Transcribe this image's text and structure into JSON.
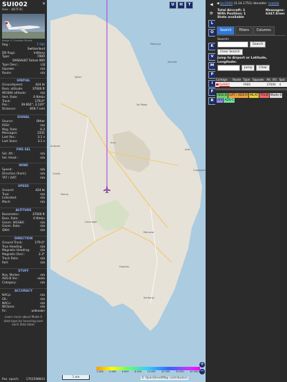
{
  "selected": {
    "callsign": "SUI002",
    "hex_label": "Hex :",
    "hex": "4B7F4C",
    "close": "✕",
    "photo_caption": "Image © Christian Mrolek"
  },
  "info_rows": [
    {
      "k": "Reg.:",
      "v": "T-785",
      "link": true
    },
    {
      "k": "",
      "v": "Switzerland"
    },
    {
      "k": "DB flags:",
      "v": "military"
    },
    {
      "k": "Type:",
      "v": "F900"
    },
    {
      "k": "",
      "v": "DASSAULT Falcon 900"
    },
    {
      "k": "Type Desc.:",
      "v": "L3J"
    },
    {
      "k": "Squawk:",
      "v": "n/a"
    },
    {
      "k": "Route:",
      "v": "n/a"
    }
  ],
  "sections": [
    {
      "title": "SPATIAL",
      "rows": [
        {
          "k": "Groundspeed:",
          "v": "424 kt"
        },
        {
          "k": "Baro. altitude:",
          "v": "37000 ft"
        },
        {
          "k": "WGS84 altitude:",
          "v": "n/a"
        },
        {
          "k": "Vert. Rate:",
          "v": "0 ft/min"
        },
        {
          "k": "Track:",
          "v": "179.0°"
        },
        {
          "k": "Pos.:",
          "v": "39.662°, 3.120°"
        },
        {
          "k": "Distance:",
          "v": "819.7 nmi"
        }
      ]
    },
    {
      "title": "SIGNAL",
      "rows": [
        {
          "k": "Source:",
          "v": "Other"
        },
        {
          "k": "RSSI:",
          "v": "n/a"
        },
        {
          "k": "Msg. Rate:",
          "v": "0.3"
        },
        {
          "k": "Messages:",
          "v": "2331"
        },
        {
          "k": "Last Pos.:",
          "v": "3.1 s"
        },
        {
          "k": "Last Seen:",
          "v": "3.1 s"
        }
      ]
    },
    {
      "title": "FMS SEL",
      "rows": [
        {
          "k": "Sel. Alt.:",
          "v": "n/a"
        },
        {
          "k": "Sel. Head.:",
          "v": "n/a"
        }
      ]
    },
    {
      "title": "WIND",
      "rows": [
        {
          "k": "Speed:",
          "v": "n/a"
        },
        {
          "k": "Direction (from):",
          "v": "n/a"
        },
        {
          "k": "TAT / OAT:",
          "v": "n/a"
        }
      ]
    },
    {
      "title": "SPEED",
      "rows": [
        {
          "k": "Ground:",
          "v": "424 kt"
        },
        {
          "k": "True:",
          "v": "n/a"
        },
        {
          "k": "Indicated:",
          "v": "n/a"
        },
        {
          "k": "Mach:",
          "v": "n/a"
        }
      ]
    },
    {
      "title": "ALTITUDE",
      "rows": [
        {
          "k": "Barometric:",
          "v": "37000 ft"
        },
        {
          "k": "Baro. Rate:",
          "v": "0 ft/min"
        },
        {
          "k": "Geom. WGS84:",
          "v": "n/a"
        },
        {
          "k": "Geom. Rate:",
          "v": "n/a"
        },
        {
          "k": "QNH:",
          "v": "n/a"
        }
      ]
    },
    {
      "title": "DIRECTION",
      "rows": [
        {
          "k": "Ground Track:",
          "v": "179.0°"
        },
        {
          "k": "True Heading:",
          "v": "n/a"
        },
        {
          "k": "Magnetic Heading:",
          "v": "n/a"
        },
        {
          "k": "Magnetic Decl.:",
          "v": "2.3°"
        },
        {
          "k": "Track Rate:",
          "v": "n/a"
        },
        {
          "k": "Roll:",
          "v": "n/a"
        }
      ]
    },
    {
      "title": "STUFF",
      "rows": [
        {
          "k": "Nav. Modes:",
          "v": "n/a"
        },
        {
          "k": "ADS-B Ver.:",
          "v": "none"
        },
        {
          "k": "Category:",
          "v": "n/a"
        }
      ]
    },
    {
      "title": "ACCURACY",
      "rows": [
        {
          "k": "NACp:",
          "v": "n/a"
        },
        {
          "k": "SIL:",
          "v": "n/a"
        },
        {
          "k": "NACv:",
          "v": "n/a"
        },
        {
          "k": "NICbaro:",
          "v": "n/a"
        },
        {
          "k": "Rc:",
          "v": "unknown"
        }
      ]
    }
  ],
  "learn_more": "Learn more about Mode S data type by hovering over each data label.",
  "pos_epoch_label": "Pos. epoch:",
  "pos_epoch": "1763598843",
  "map": {
    "top_buttons": [
      "U",
      "H",
      "T"
    ],
    "places": [
      "Pollença",
      "Alcúdia",
      "Sóller",
      "Inca",
      "Sa Pobla",
      "Manacor",
      "Felanitx",
      "Santanyí",
      "Llucmajor",
      "Palma",
      "Calvià",
      "Andratx",
      "Artà",
      "Capdepera"
    ],
    "scale": "1 nm",
    "color_ticks": [
      "2 000",
      "4 000",
      "6 000",
      "8 000",
      "10 000",
      "20 000",
      "30 000",
      "40 000+"
    ],
    "attribution": "© OpenStreetMap contributors",
    "zoom_in": "+",
    "zoom_out": "−"
  },
  "side_buttons": [
    "◀",
    "⟳",
    "L",
    "O",
    "K",
    "V",
    "M",
    "P",
    "I",
    "F",
    "R"
  ],
  "right": {
    "version_prefix": "◀ ",
    "version_link": "tar1090",
    "version_suffix": " (3.14.1751) decoder: ",
    "decoder_link": "readsb",
    "total_label": "Total Aircraft:",
    "total": "1",
    "messages_label": "Messages:",
    "messages": "6347.8/sec",
    "with_pos_label": "With Position:",
    "with_pos": "1",
    "stats_label": "Stats available",
    "tabs": [
      "Search",
      "Filters",
      "Columns"
    ],
    "search_label": "Search:",
    "search_button": "Search",
    "clear_search": "Clear Search",
    "jump_label": "Jump to Airport or Latitude, Longitude:",
    "jump_button": "Jump",
    "clear_button": "Clear",
    "table_headers": [
      "Callsign",
      "Route",
      "Type",
      "Squawk",
      "Alt. (ft)",
      "Spd."
    ],
    "table_rows": [
      {
        "callsign": "SUI002",
        "route": "",
        "type": "F900",
        "squawk": "",
        "alt": "37000",
        "spd": "4"
      }
    ],
    "legend": [
      {
        "label": "ADS-B",
        "color": "#6ccf6c"
      },
      {
        "label": "UAT / ADS-R",
        "color": "#f0a040"
      },
      {
        "label": "MLAT",
        "color": "#e8d040"
      },
      {
        "label": "TIS-B",
        "color": "#f06868"
      },
      {
        "label": "Mode-S",
        "color": "#dddddd"
      },
      {
        "label": "AIS",
        "color": "#9090f0"
      },
      {
        "label": "ADS-C",
        "color": "#70e0a0"
      }
    ]
  }
}
